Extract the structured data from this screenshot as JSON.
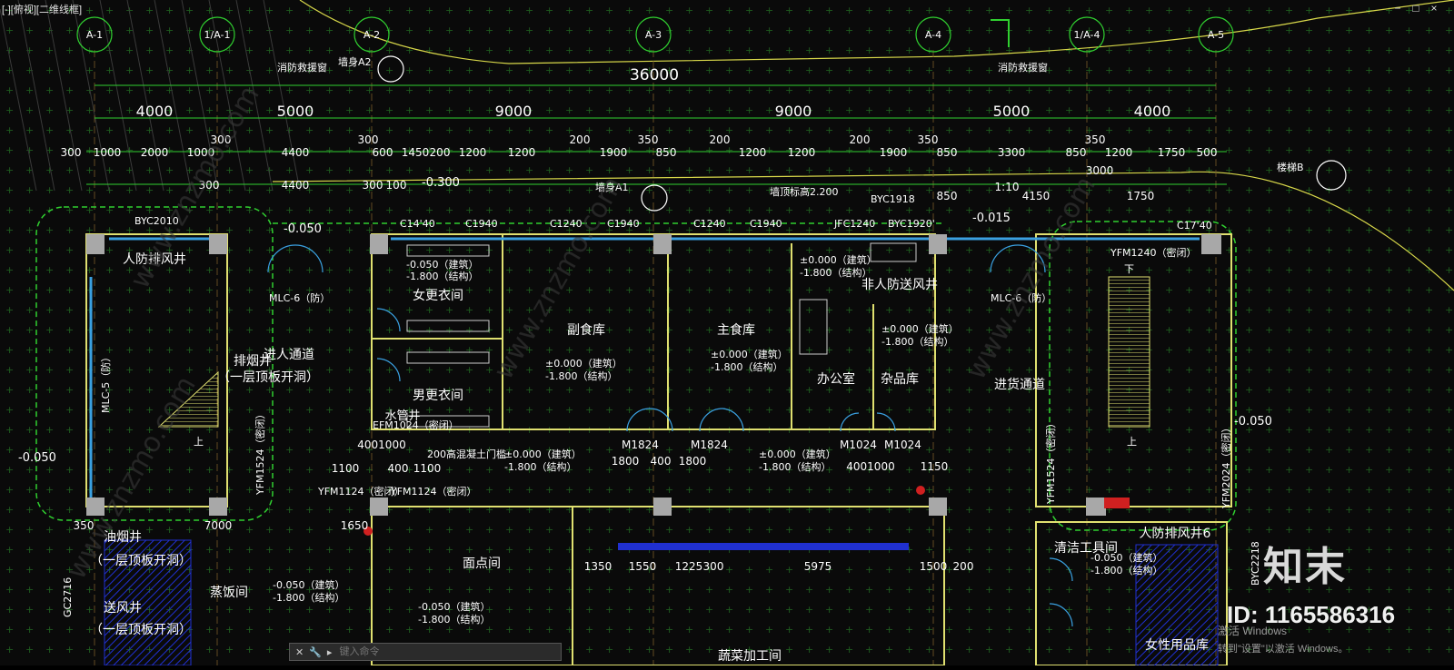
{
  "viewport": {
    "label": "[-][俯视][二维线框]"
  },
  "window_controls": [
    "−",
    "□",
    "×"
  ],
  "grid_axes": [
    {
      "id": "A-1"
    },
    {
      "id": "1/A-1"
    },
    {
      "id": "A-2"
    },
    {
      "id": "A-3"
    },
    {
      "id": "A-4"
    },
    {
      "id": "1/A-4"
    },
    {
      "id": "A-5"
    }
  ],
  "dimensions": {
    "total": "36000",
    "bays": [
      "4000",
      "5000",
      "9000",
      "9000",
      "5000",
      "4000"
    ],
    "row1": [
      "300",
      "1000",
      "2000",
      "1000",
      "300",
      "300",
      "600",
      "1450",
      "200",
      "1200",
      "1200",
      "200",
      "1900",
      "350",
      "850",
      "200",
      "1200",
      "1200",
      "200",
      "1900",
      "350",
      "850",
      "3300",
      "850",
      "350",
      "1200",
      "1750",
      "500",
      "4400"
    ],
    "row2": [
      "300",
      "4400",
      "300",
      "100",
      "1750",
      "850",
      "4150",
      "3000",
      "1:10"
    ]
  },
  "rooms": [
    {
      "name": "人防排风井"
    },
    {
      "name": "女更衣间"
    },
    {
      "name": "男更衣间"
    },
    {
      "name": "副食库"
    },
    {
      "name": "主食库"
    },
    {
      "name": "办公室"
    },
    {
      "name": "杂品库"
    },
    {
      "name": "非人防送风井"
    },
    {
      "name": "进货通道"
    },
    {
      "name": "进人通道"
    },
    {
      "name": "排烟井"
    },
    {
      "name": "（一层顶板开洞）"
    },
    {
      "name": "水管井"
    },
    {
      "name": "油烟井"
    },
    {
      "name": "送风井"
    },
    {
      "name": "蒸饭间"
    },
    {
      "name": "面点间"
    },
    {
      "name": "蔬菜加工间"
    },
    {
      "name": "清洁工具间"
    },
    {
      "name": "人防排风井6"
    },
    {
      "name": "女性用品库"
    }
  ],
  "labels": {
    "elev_zero": "±0.000（建筑）",
    "elev_struct": "-1.800（结构）",
    "elev_neg": "-0.050（建筑）",
    "elev_300": "-0.300",
    "elev_015": "-0.015",
    "elev_050": "-0.050",
    "wall_note": "墙身A1",
    "wall_note2": "墙身A2",
    "wall_top": "墙顶标高2.200",
    "fire_window": "消防救援窗",
    "fire_window2": "消防救援窗",
    "stair_b": "楼梯B",
    "up_arrow": "上",
    "down_arrow": "下",
    "mlc6": "MLC-6（防）",
    "mlc5": "MLC-5（防）",
    "note_rise": "300",
    "doors": [
      "C14'40",
      "C1940",
      "C1240",
      "C1940",
      "C1240",
      "C1940",
      "JFC1240",
      "BYC1920'",
      "C17'40",
      "BYC2010",
      "BYC1918",
      "M1824",
      "M1824",
      "M1024",
      "M1024",
      "YFM1124（密闭）",
      "YFM1124（密闭）",
      "YFM1524（密闭）",
      "YFM2024（密闭）",
      "YFM1240（密闭）",
      "EFM1024（密闭）",
      "GC2716",
      "BYC2218"
    ],
    "top_left_dims": [
      "1100",
      "400",
      "1100",
      "4001000",
      "1650",
      "7000",
      "350",
      "1008"
    ],
    "bottom_dims": [
      "1350",
      "1550",
      "1225",
      "300",
      "5975",
      "1500",
      "200",
      "1000",
      "4001000",
      "1150",
      "1800",
      "400",
      "1800"
    ],
    "drain": "200高混凝土门槛"
  },
  "cmdbar": {
    "placeholder": "键入命令"
  },
  "watermark": {
    "brand": "知末",
    "id": "ID: 1165586316",
    "activation_line1": "激活 Windows",
    "activation_line2": "转到\"设置\"以激活 Windows。"
  },
  "colors": {
    "background": "#0a0a0a",
    "grid": "#1a6e1a",
    "wall": "#e0e070",
    "dim": "#30d030",
    "text": "#ffffff",
    "hatch": "#2030d0"
  }
}
